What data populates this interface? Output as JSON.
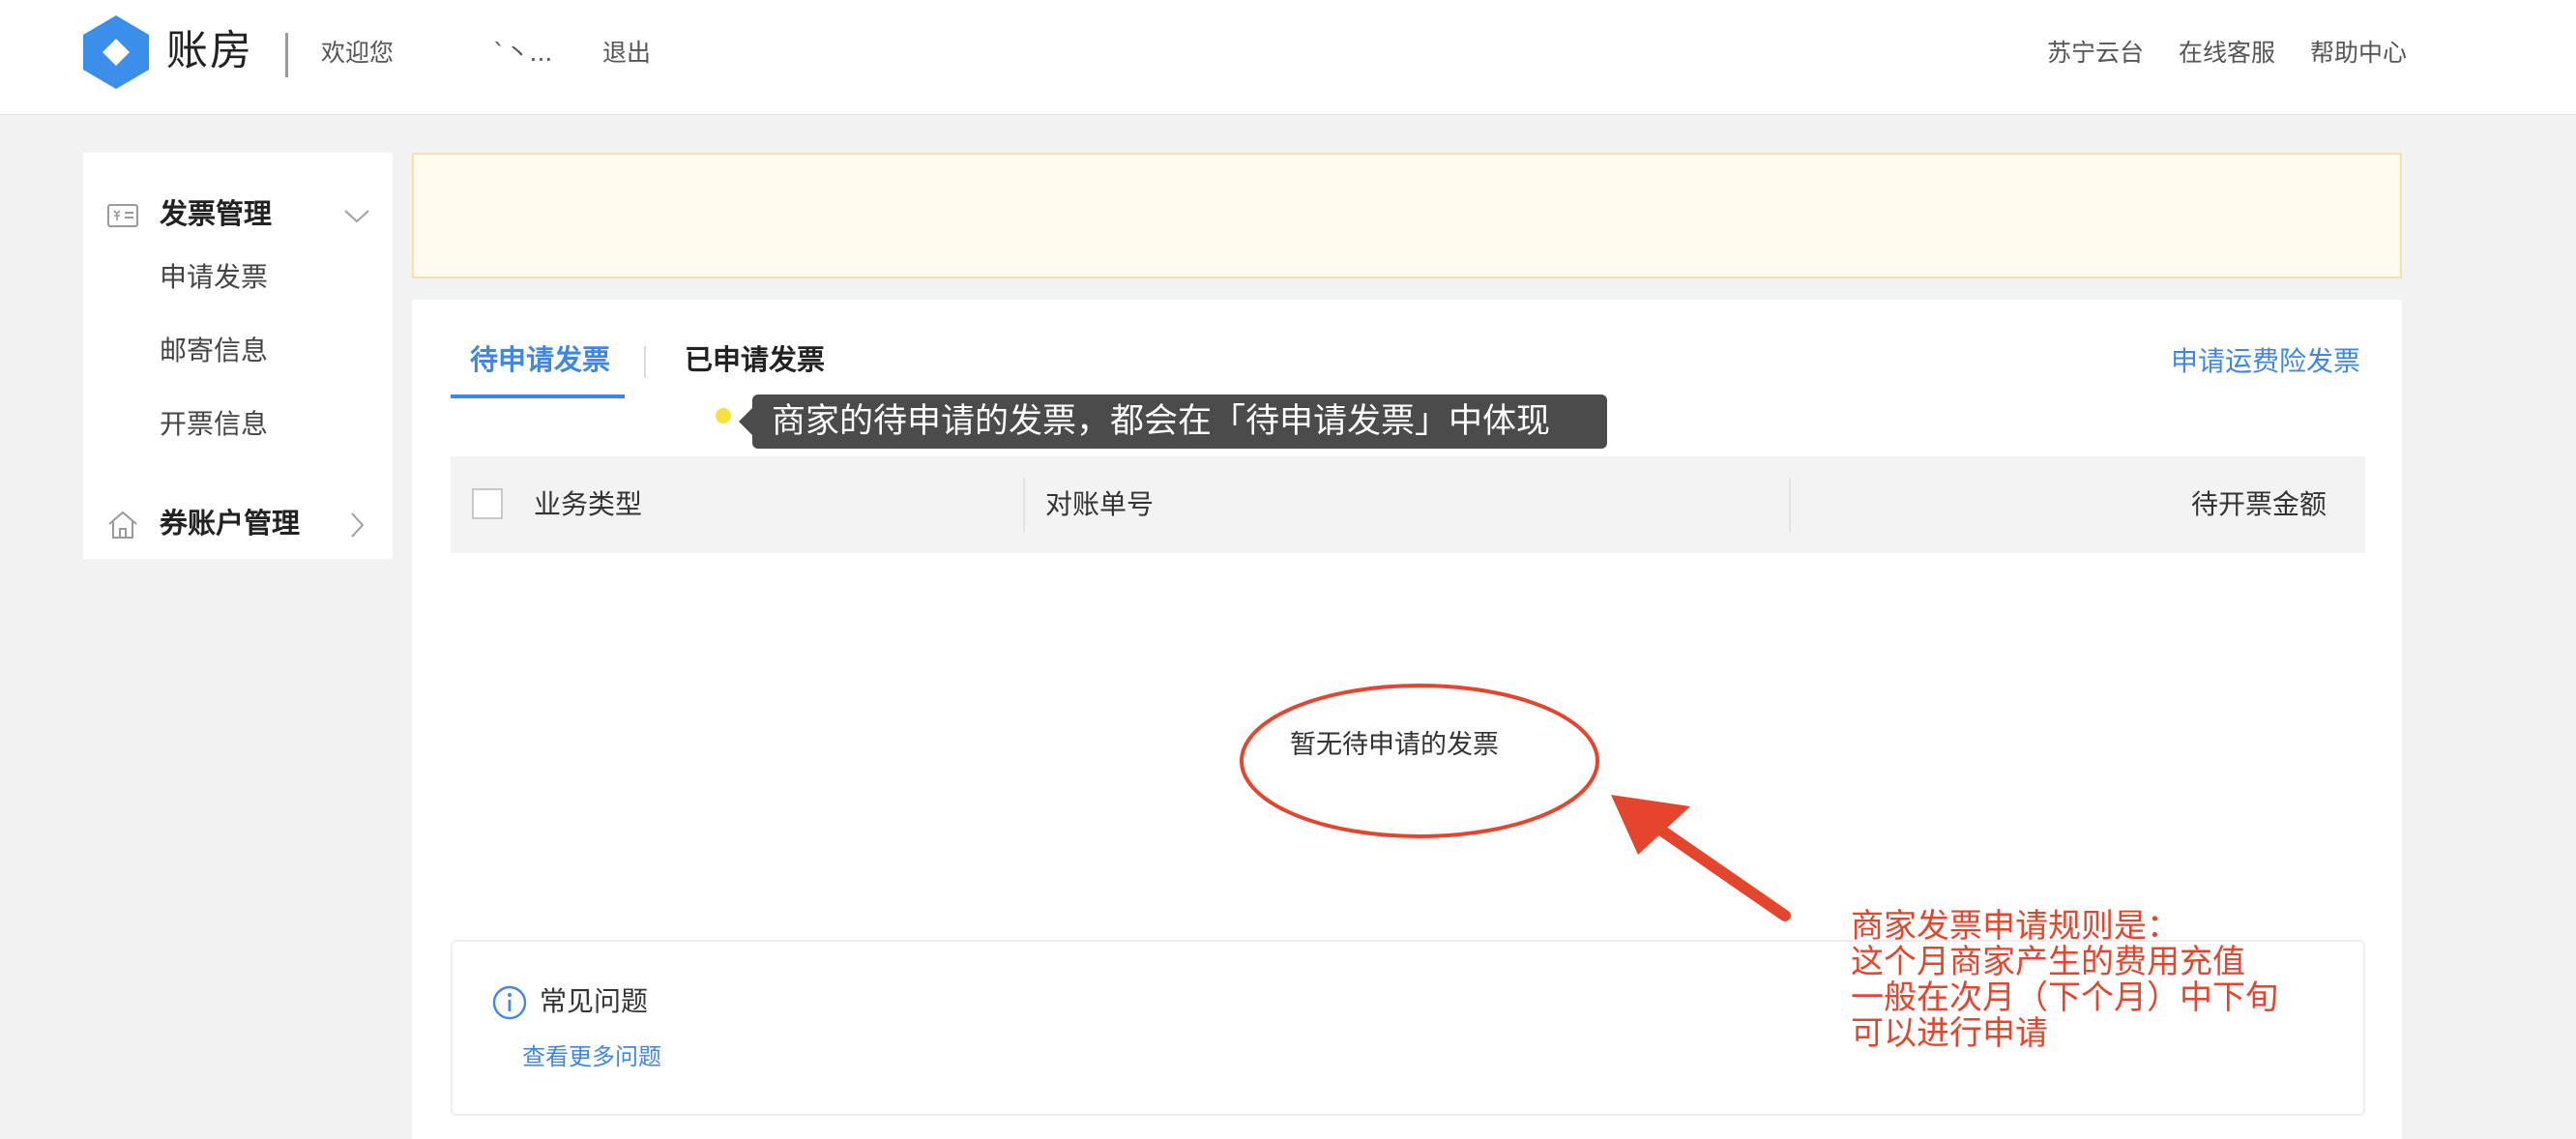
{
  "header": {
    "app_name": "账房",
    "welcome": "欢迎您",
    "username": "`丶...",
    "logout": "退出",
    "links": [
      "苏宁云台",
      "在线客服",
      "帮助中心"
    ]
  },
  "sidebar": {
    "groups": [
      {
        "label": "发票管理",
        "icon": "invoice-icon",
        "expanded": true,
        "items": [
          "申请发票",
          "邮寄信息",
          "开票信息"
        ]
      },
      {
        "label": "券账户管理",
        "icon": "home-icon",
        "expanded": false,
        "items": []
      }
    ]
  },
  "tabs": [
    "待申请发票",
    "已申请发票"
  ],
  "active_tab": "待申请发票",
  "freight_link": "申请运费险发票",
  "table": {
    "headers": [
      "业务类型",
      "对账单号",
      "待开票金额"
    ],
    "rows": []
  },
  "empty_text": "暂无待申请的发票",
  "faq": {
    "title": "常见问题",
    "more": "查看更多问题"
  },
  "annotations": {
    "tooltip": "商家的待申请的发票，都会在「待申请发票」中体现",
    "rule_lines": [
      "商家发票申请规则是：",
      "这个月商家产生的费用充值",
      "一般在次月（下个月）中下旬",
      "可以进行申请"
    ]
  },
  "colors": {
    "accent": "#3f86e8",
    "annotation": "#e5452d",
    "notice_bg": "#fffcef"
  }
}
